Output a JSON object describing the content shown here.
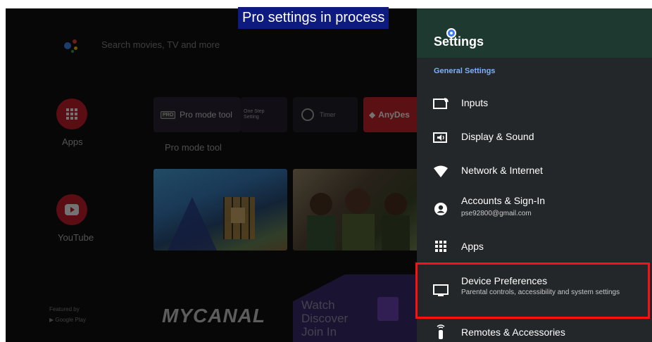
{
  "overlay": {
    "banner": "Pro settings in process"
  },
  "home": {
    "search_placeholder": "Search movies, TV and more",
    "sidebar": [
      {
        "label": "Apps",
        "icon": "apps-grid-icon"
      },
      {
        "label": "YouTube",
        "icon": "youtube-icon"
      }
    ],
    "tiles": {
      "pro_mode": "Pro mode tool",
      "one_step": "One Step Setting",
      "timer": "Timer",
      "anydesk": "AnyDes",
      "pro_mode_caption": "Pro mode tool"
    },
    "featured_by": "Featured by",
    "google_play": "Google Play",
    "mycanal": "MYCANAL",
    "twitch_tagline": [
      "Watch",
      "Discover",
      "Join In"
    ]
  },
  "settings": {
    "title": "Settings",
    "section": "General Settings",
    "items": [
      {
        "label": "Inputs",
        "icon": "input-icon"
      },
      {
        "label": "Display & Sound",
        "icon": "display-sound-icon"
      },
      {
        "label": "Network & Internet",
        "icon": "wifi-icon"
      },
      {
        "label": "Accounts & Sign-In",
        "sublabel": "pse92800@gmail.com",
        "icon": "account-icon"
      },
      {
        "label": "Apps",
        "icon": "apps-grid-icon"
      },
      {
        "label": "Device Preferences",
        "sublabel": "Parental controls, accessibility and system settings",
        "icon": "tv-monitor-icon"
      },
      {
        "label": "Remotes & Accessories",
        "icon": "remote-icon"
      }
    ]
  },
  "colors": {
    "banner_bg": "#0d1a80",
    "settings_header": "#1e3a30",
    "section_accent": "#7ab0ff",
    "highlight": "#ff1010"
  }
}
